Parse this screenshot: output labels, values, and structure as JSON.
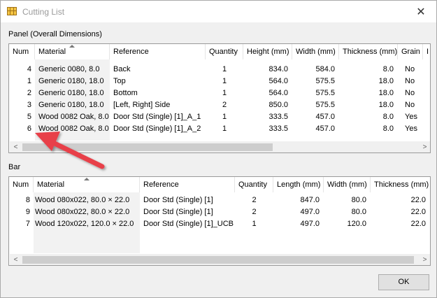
{
  "window": {
    "title": "Cutting List",
    "close_glyph": "✕",
    "app_icon": "cutting-list-icon"
  },
  "panel_section": {
    "label": "Panel (Overall Dimensions)",
    "columns": [
      "Num",
      "Material",
      "Reference",
      "Quantity",
      "Height (mm)",
      "Width (mm)",
      "Thickness (mm)",
      "Grain",
      "I"
    ],
    "sorted_column": "Material",
    "rows": [
      {
        "num": "4",
        "material": "Generic 0080, 8.0",
        "reference": "Back",
        "quantity": "1",
        "height": "834.0",
        "width": "584.0",
        "thickness": "8.0",
        "grain": "No"
      },
      {
        "num": "1",
        "material": "Generic 0180, 18.0",
        "reference": "Top",
        "quantity": "1",
        "height": "564.0",
        "width": "575.5",
        "thickness": "18.0",
        "grain": "No"
      },
      {
        "num": "2",
        "material": "Generic 0180, 18.0",
        "reference": "Bottom",
        "quantity": "1",
        "height": "564.0",
        "width": "575.5",
        "thickness": "18.0",
        "grain": "No"
      },
      {
        "num": "3",
        "material": "Generic 0180, 18.0",
        "reference": "[Left, Right] Side",
        "quantity": "2",
        "height": "850.0",
        "width": "575.5",
        "thickness": "18.0",
        "grain": "No"
      },
      {
        "num": "5",
        "material": "Wood 0082 Oak, 8.0",
        "reference": "Door Std (Single) [1]_A_1",
        "quantity": "1",
        "height": "333.5",
        "width": "457.0",
        "thickness": "8.0",
        "grain": "Yes"
      },
      {
        "num": "6",
        "material": "Wood 0082 Oak, 8.0",
        "reference": "Door Std (Single) [1]_A_2",
        "quantity": "1",
        "height": "333.5",
        "width": "457.0",
        "thickness": "8.0",
        "grain": "Yes"
      }
    ]
  },
  "bar_section": {
    "label": "Bar",
    "columns": [
      "Num",
      "Material",
      "Reference",
      "Quantity",
      "Length (mm)",
      "Width (mm)",
      "Thickness (mm)"
    ],
    "sorted_column": "Material",
    "rows": [
      {
        "num": "8",
        "material": "Wood 080x022, 80.0 × 22.0",
        "reference": "Door Std (Single) [1]",
        "quantity": "2",
        "length": "847.0",
        "width": "80.0",
        "thickness": "22.0"
      },
      {
        "num": "9",
        "material": "Wood 080x022, 80.0 × 22.0",
        "reference": "Door Std (Single) [1]",
        "quantity": "2",
        "length": "497.0",
        "width": "80.0",
        "thickness": "22.0"
      },
      {
        "num": "7",
        "material": "Wood 120x022, 120.0 × 22.0",
        "reference": "Door Std (Single) [1]_UCB",
        "quantity": "1",
        "length": "497.0",
        "width": "120.0",
        "thickness": "22.0"
      }
    ]
  },
  "scrollbar": {
    "left_glyph": "<",
    "right_glyph": ">"
  },
  "buttons": {
    "ok": "OK"
  },
  "colors": {
    "arrow": "#e8404a",
    "window_bg": "#f0f0f0",
    "list_bg": "#ffffff"
  }
}
